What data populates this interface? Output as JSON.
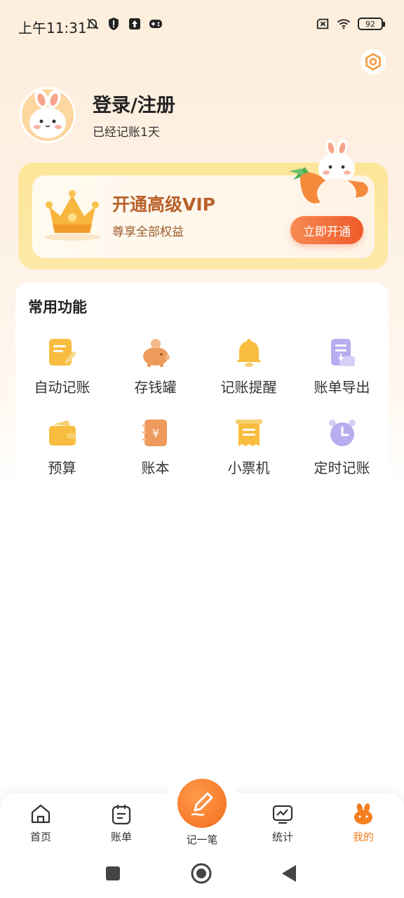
{
  "status_bar": {
    "time": "上午11:31",
    "battery": "92",
    "icons": [
      "bell-muted-icon",
      "shield-icon",
      "upload-icon",
      "gamepad-icon",
      "sim-off-icon",
      "wifi-icon",
      "battery-icon"
    ]
  },
  "profile": {
    "title": "登录/注册",
    "subtitle": "已经记账1天"
  },
  "vip": {
    "title": "开通高级VIP",
    "subtitle": "尊享全部权益",
    "button": "立即开通"
  },
  "functions": {
    "title": "常用功能",
    "items": [
      {
        "label": "自动记账",
        "icon": "auto-record-icon"
      },
      {
        "label": "存钱罐",
        "icon": "piggy-bank-icon"
      },
      {
        "label": "记账提醒",
        "icon": "bell-icon"
      },
      {
        "label": "账单导出",
        "icon": "export-icon"
      },
      {
        "label": "预算",
        "icon": "wallet-icon"
      },
      {
        "label": "账本",
        "icon": "ledger-icon"
      },
      {
        "label": "小票机",
        "icon": "receipt-icon"
      },
      {
        "label": "定时记账",
        "icon": "alarm-clock-icon"
      }
    ]
  },
  "nav": {
    "home": "首页",
    "bills": "账单",
    "record": "记一笔",
    "stats": "统计",
    "mine": "我的",
    "active": "mine"
  },
  "colors": {
    "accent": "#f37f1f",
    "vip_text": "#b8612a",
    "icon_yellow": "#f8bd3e",
    "icon_orange": "#ee9a5c",
    "icon_purple": "#b7aef0"
  }
}
